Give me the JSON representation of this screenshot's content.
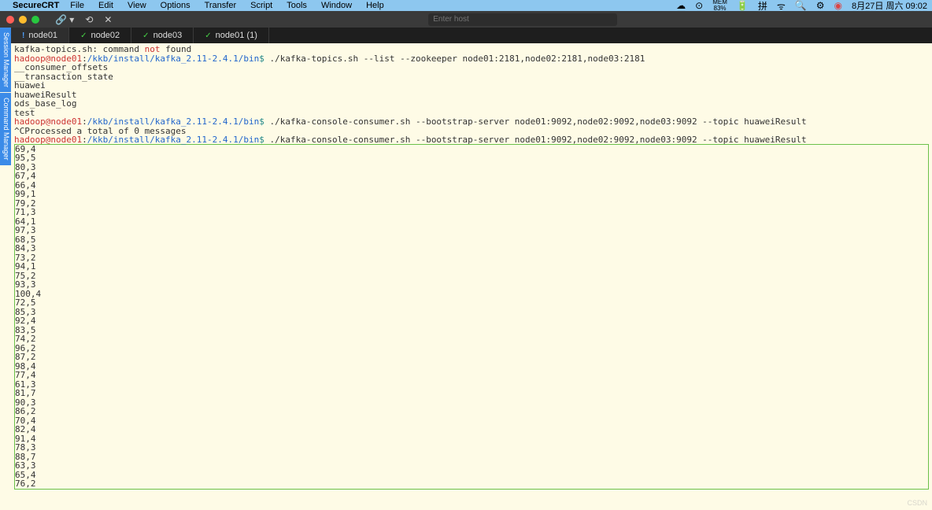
{
  "menubar": {
    "app": "SecureCRT",
    "menus": [
      "File",
      "Edit",
      "View",
      "Options",
      "Transfer",
      "Script",
      "Tools",
      "Window",
      "Help"
    ],
    "mem_label": "MEM",
    "mem_value": "83%",
    "input_badge": "拼",
    "date_time": "8月27日 周六 09:02"
  },
  "titlebar": {
    "host_placeholder": "Enter host"
  },
  "side_tabs": [
    "Session Manager",
    "Command Manager"
  ],
  "tabs": [
    {
      "label": "node01",
      "status": "warn"
    },
    {
      "label": "node02",
      "status": "check"
    },
    {
      "label": "node03",
      "status": "check"
    },
    {
      "label": "node01 (1)",
      "status": "check"
    }
  ],
  "terminal": {
    "prompt_user": "hadoop@node01",
    "prompt_path": "/kkb/install/kafka_2.11-2.4.1/bin",
    "cmd_error_prefix": "kafka-topics.sh: command ",
    "cmd_error_red": "not",
    "cmd_error_suffix": " found",
    "cmd_list": " ./kafka-topics.sh --list --zookeeper node01:2181,node02:2181,node03:2181",
    "topics": [
      "__consumer_offsets",
      "__transaction_state",
      "huawei",
      "huaweiResult",
      "ods_base_log",
      "test"
    ],
    "cmd_consumer": " ./kafka-console-consumer.sh --bootstrap-server node01:9092,node02:9092,node03:9092 --topic huaweiResult",
    "proc_msg": "^CProcessed a total of 0 messages",
    "data_rows": [
      "69,4",
      "95,5",
      "80,3",
      "67,4",
      "66,4",
      "99,1",
      "79,2",
      "71,3",
      "64,1",
      "97,3",
      "68,5",
      "84,3",
      "73,2",
      "94,1",
      "75,2",
      "93,3",
      "100,4",
      "72,5",
      "85,3",
      "92,4",
      "83,5",
      "74,2",
      "96,2",
      "87,2",
      "98,4",
      "77,4",
      "61,3",
      "81,7",
      "90,3",
      "86,2",
      "70,4",
      "82,4",
      "91,4",
      "78,3",
      "88,7",
      "63,3",
      "65,4",
      "76,2"
    ]
  }
}
